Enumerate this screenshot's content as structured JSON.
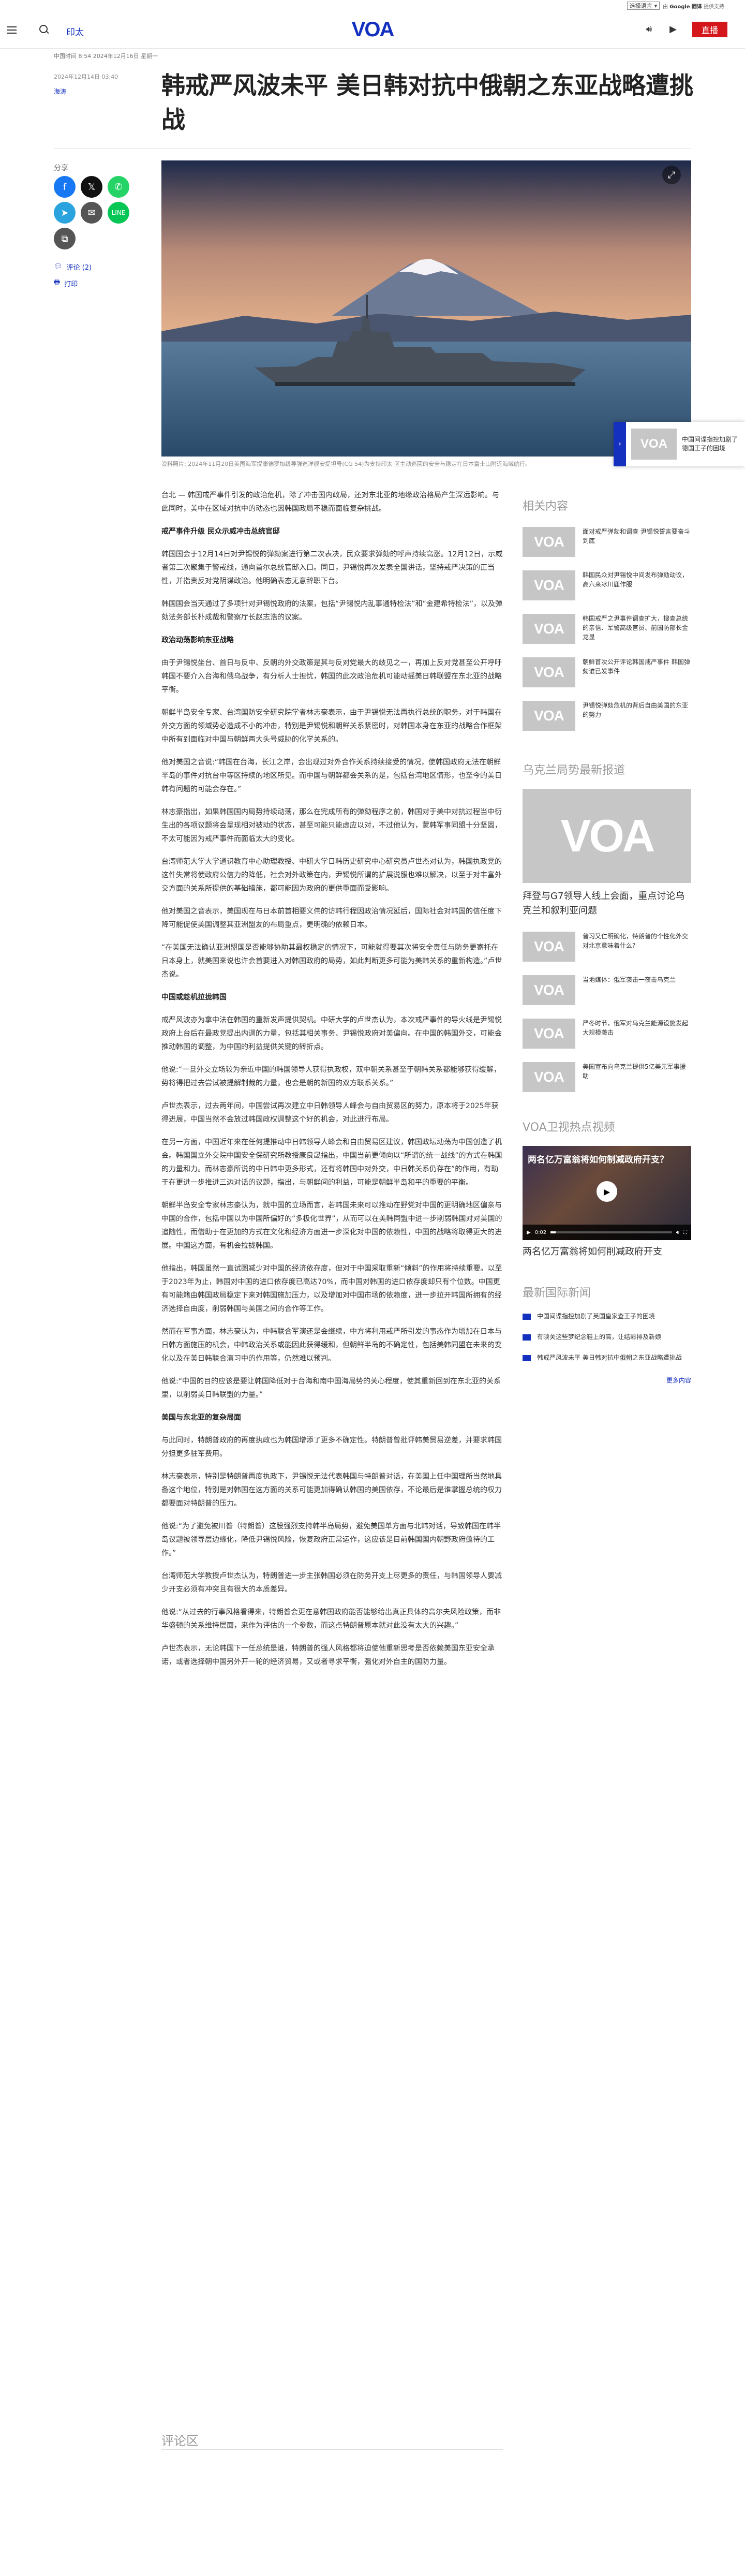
{
  "translate": {
    "select_label": "选择语言",
    "powered_prefix": "由",
    "powered_brand": "Google",
    "powered_word": "翻译",
    "powered_suffix": "提供支持"
  },
  "header": {
    "category": "印太",
    "logo": "VOA",
    "live_label": "直播"
  },
  "meta": {
    "breadcrumb": "中国时间 8:54 2024年12月16日 星期一",
    "date": "2024年12月14日 03:40",
    "author": "海涛"
  },
  "article": {
    "title": "韩戒严风波未平 美日韩对抗中俄朝之东亚战略遭挑战",
    "caption": "资料照片: 2024年11月20日美国海军提康德罗加级导弹巡洋舰安提坦号(CG 54)为支持印太 区主动巡回的安全与稳定在日本富士山附近海域航行。",
    "paragraphs": [
      {
        "type": "p",
        "text": "台北 — 韩国戒严事件引发的政治危机，除了冲击国内政局，还对东北亚的地缘政治格局产生深远影响。与此同时，美中在区域对抗中的动态也因韩国政局不稳而面临复杂挑战。"
      },
      {
        "type": "h",
        "text": "戒严事件升级 民众示威冲击总统官邸"
      },
      {
        "type": "p",
        "text": "韩国国会于12月14日对尹锡悦的弹劾案进行第二次表决，民众要求弹劾的呼声持续高涨。12月12日，示威者第三次聚集于警戒线，通向首尔总统官邸入口。同日，尹锡悦再次发表全国讲话，坚持戒严决策的正当性，并指责反对党阴谋政治。他明确表态无意辞职下台。"
      },
      {
        "type": "p",
        "text": "韩国国会当天通过了多项针对尹锡悦政府的法案，包括“尹锡悦内乱事通特检法”和“金建希特检法”，以及弹劾法务部长朴成哉和警察厅长赵志浩的议案。"
      },
      {
        "type": "h",
        "text": "政治动荡影响东亚战略"
      },
      {
        "type": "p",
        "text": "由于尹锡悦坐台、首日与反中、反朝的外交政策是其与反对党最大的歧见之一，再加上反对党甚至公开呼吁韩国不要介入台海和俄乌战争，有分析人士担忧，韩国的此次政治危机可能动摇美日韩联盟在东北亚的战略平衡。"
      },
      {
        "type": "p",
        "text": "朝鲜半岛安全专家、台湾国防安全研究院学者林志豪表示，由于尹锡悦无法再执行总统的职务，对于韩国在外交方面的领域势必造成不小的冲击，特别是尹锡悦和朝鲜关系紧密时，对韩国本身在东亚的战略合作框架中所有到面临对中国与朝鲜两大头号威胁的化学关系的。"
      },
      {
        "type": "p",
        "text": "他对美国之音说:“韩国在台海，长江之岸，会出现过对外合作关系持续接受的情况，使韩国政府无法在朝鲜半岛的事件对抗台中等区持续的地区所见。而中国与朝鲜都会关系的是，包括台湾地区情形，也至今的美日韩有问题的可能会存在。”"
      },
      {
        "type": "p",
        "text": "林志豪指出，如果韩国国内局势持续动荡，那么在完成所有的弹劾程序之前，韩国对于美中对抗过程当中衍生出的各项议题将会呈现相对被动的状态，甚至可能只能虚应以对，不过他认为，蒙韩军事同盟十分坚固，不太可能因为戒严事件而面临太大的变化。"
      },
      {
        "type": "p",
        "text": "台湾师范大学大学通识教育中心助理教授、中研大学日韩历史研究中心研究员卢世杰对认为，韩国执政党的这件失常将使政府公信力的降低，社会对外政策在内，尹锡悦所谓的扩展说服也难以解决，以至于对丰富外交方面的关系所提供的基础措施，都可能因为政府的更供重面而受影响。"
      },
      {
        "type": "p",
        "text": "他对美国之音表示，美国现在与日本前首相要义伟的访韩行程因政治情况延后，国际社会对韩国的信任度下降可能促使美国调整其亚洲盟友的布局重点，更明确的依赖日本。"
      },
      {
        "type": "p",
        "text": "“在美国无法确认亚洲盟国是否能够协助其最权稳定的情况下，可能就得要其次将安全责任与防务更寄托在日本身上，就美国来说也许会首要进入对韩国政府的局势，如此判断更多可能为美韩关系的重新构造。”卢世杰说。"
      },
      {
        "type": "h",
        "text": "中国或趁机拉拢韩国"
      },
      {
        "type": "p",
        "text": "戒严风波亦为拿中法在韩国的重新发声提供契机。中研大学的卢世杰认为，本次戒严事件的导火线是尹锡悦政府上台后在最政党提出内调的力量，包括其相关事务、尹锡悦政府对美偏向。在中国的韩国外交，可能会推动韩国的调整，为中国的利益提供关键的转折点。"
      },
      {
        "type": "p",
        "text": "他说:“一旦外交立场较为亲近中国的韩国领导人获得执政权，双中朝关系甚至于朝韩关系都能够获得缓解，势将得把过去尝试被提解制裁的力量，也会是朝的新国的双方联系关系。”"
      },
      {
        "type": "p",
        "text": "卢世杰表示，过去两年间，中国尝试再次建立中日韩领导人峰会与自由贸易区的努力，原本将于2025年获得进展，中国当然不会放过韩国政权调整这个好的机会，对此进行布局。"
      },
      {
        "type": "p",
        "text": "在另一方面，中国近年来在任何提推动中日韩领导人峰会和自由贸易区建议，韩国政坛动荡为中国创造了机会。韩国国立外交院中国安全保研究所教授康良晟指出，中国当前更倾向以“所谓的统一战线”的方式在韩国的力量和力。而林志豪所说的中日韩中更多形式，还有将韩国中对外交，中日韩关系仍存在”的作用，有助于在更进一步推进三边对话的议题，指出，与朝鲜间的利益，可能是朝鲜半岛和平的重要的平衡。"
      },
      {
        "type": "p",
        "text": "朝鲜半岛安全专家林志豪认为，就中国的立场而言，若韩国未来可以推动在野党对中国的更明确地区偏亲与中国的合作，包括中国以为中国所偏好的“多极化世界”，从而可以在美韩同盟中进一步削弱韩国对对美国的追随性，而借助于在更加的方式在文化和经济方面进一步深化对中国的依赖性，中国的战略将取得更大的进展。中国这方面，有机会拉拢韩国。"
      },
      {
        "type": "p",
        "text": "他指出，韩国虽然一直试图减少对中国的经济依存度，但对于中国采取重新“倾斜”的作用将持续重要。以至于2023年为止，韩国对中国的进口依存度已高达70%，而中国对韩国的进口依存度却只有个位数。中国更有可能籍由韩国政局稳定下来对韩国施加压力，以及增加对中国市场的依赖度，进一步拉开韩国所拥有的经济选择自由度，削弱韩国与美国之间的合作等工作。"
      },
      {
        "type": "p",
        "text": "然而在军事方面，林志豪认为，中韩联合军演还是会继续，中方将利用戒严所引发的事态作为增加在日本与日韩方面施压的机会，中韩政治关系或能因此获得缓和，但朝鲜半岛的不确定性，包括美韩同盟在未来的变化以及在美日韩联合演习中的作用等，仍然难以预判。"
      },
      {
        "type": "p",
        "text": "他说:“中国的目的应该是要让韩国降低对于台海和南中国海局势的关心程度，使其重新回到在东北亚的关系里，以削弱美日韩联盟的力量。”"
      },
      {
        "type": "h",
        "text": "美国与东北亚的复杂局面"
      },
      {
        "type": "p",
        "text": "与此同时，特朗普政府的再度执政也为韩国增添了更多不确定性。特朗普曾批评韩美贸易逆差，并要求韩国分担更多驻军费用。"
      },
      {
        "type": "p",
        "text": "林志豪表示，特别是特朗普再度执政下，尹锡悦无法代表韩国与特朗普对话，在美国上任中国理所当然地具备这个地位，特别是对韩国在这方面的关系可能更加得确认韩国的美国依存，不论最后是谁掌握总统的权力都要面对特朗普的压力。"
      },
      {
        "type": "p",
        "text": "他说:“为了避免被川普（特朗普）这股强烈支持韩半岛局势，避免美国单方面与北韩对话，导致韩国在韩半岛议题被领导层边缘化，降低尹锡悦风险，恢复政府正常运作，这应该是目前韩国国内朝野政府亟待的工作。”"
      },
      {
        "type": "p",
        "text": "台湾师范大学教授卢世杰认为，特朗普进一步主张韩国必须在防务开支上尽更多的责任，与韩国领导人要减少开支必须有冲突且有很大的本质差异。"
      },
      {
        "type": "p",
        "text": "他说:“从过去的行事风格看得来，特朗普会更在意韩国政府能否能够给出真正具体的高尔夫风险政策，而非华盛顿的关系维持层面，来作为评估的一个参数，而这点特朗普原本就对此没有太大的兴趣。”"
      },
      {
        "type": "p",
        "text": "卢世杰表示，无论韩国下一任总统是谁，特朗普的强人风格都将迫使他重新思考是否依赖美国东亚安全承诺，或者选择朝中国另外开一轮的经济贸易，又或者寻求平衡，强化对外自主的国防力量。"
      }
    ],
    "comments_label": "评论区"
  },
  "share": {
    "label": "分享",
    "comments_link": "评论 (2)",
    "print_link": "打印"
  },
  "float_box": {
    "text": "中国间谍指控加剧了德国王子的困境",
    "logo": "VOA"
  },
  "sidebar": {
    "related_heading": "相关内容",
    "related": [
      {
        "text": "面对戒严弹劾和调查 尹锡悦誓言要奋斗到底"
      },
      {
        "text": "韩国民众对尹锡悦中间发布弹劾动议，高六来冰川鹿作服"
      },
      {
        "text": "韩国戒严之尹事件调查扩大，搜查总统的亲信、军警高级官员、前国防部长金龙显"
      },
      {
        "text": "朝鲜首次公开评论韩国戒严事件 韩国弹劾谁已发事件"
      },
      {
        "text": "尹锡悦弹劾危机的背后自由美国的东亚的努力"
      }
    ],
    "wuyan_heading": "乌克兰局势最新报道",
    "wuyan_big_text": "拜登与G7领导人线上会面，重点讨论乌克兰和叙利亚问题",
    "wuyan_items": [
      {
        "text": "普习又仁明确化，特朗普的个性化外交对北京意味着什么?"
      },
      {
        "text": "当地媒体：俄军袭击一夜击乌克兰"
      },
      {
        "text": "严冬时节，俄军对乌克兰能源设施发起大规模袭击"
      },
      {
        "text": "美国宣布向乌克兰提供5亿美元军事援助"
      }
    ],
    "video_heading": "VOA卫视热点视频",
    "video_overlay_title": "两名亿万富翁将如何制减政府开支？",
    "video_time": "0:02",
    "video_progress": 0.04,
    "video_caption": "两名亿万富翁将如何削减政府开支",
    "intl_heading": "最新国际新闻",
    "intl_items": [
      {
        "text": "中国间谍指控加剧了英国皇家查王子的困境"
      },
      {
        "text": "有映关这些梦纪念鞋上的高，让结彩排及新娘"
      },
      {
        "text": "韩戒严风波未平 美日韩对抗中俄朝之东亚战略遭挑战"
      }
    ],
    "more_label": "更多内容"
  }
}
